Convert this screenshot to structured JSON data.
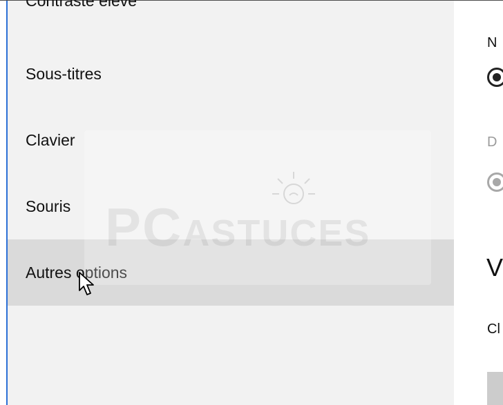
{
  "sidebar": {
    "items": [
      {
        "label": "Contraste élevé"
      },
      {
        "label": "Sous-titres"
      },
      {
        "label": "Clavier"
      },
      {
        "label": "Souris"
      },
      {
        "label": "Autres options"
      }
    ],
    "selected": "Autres options"
  },
  "watermark": {
    "pc": "PC",
    "astuces": "ASTUCES"
  },
  "content": {
    "label1": "N",
    "label2": "D",
    "heading": "V",
    "label3": "Cl"
  },
  "colors": {
    "accent": "#2b6fd6",
    "sidebar_bg": "#f2f2f2",
    "selected_bg": "#dadada"
  }
}
